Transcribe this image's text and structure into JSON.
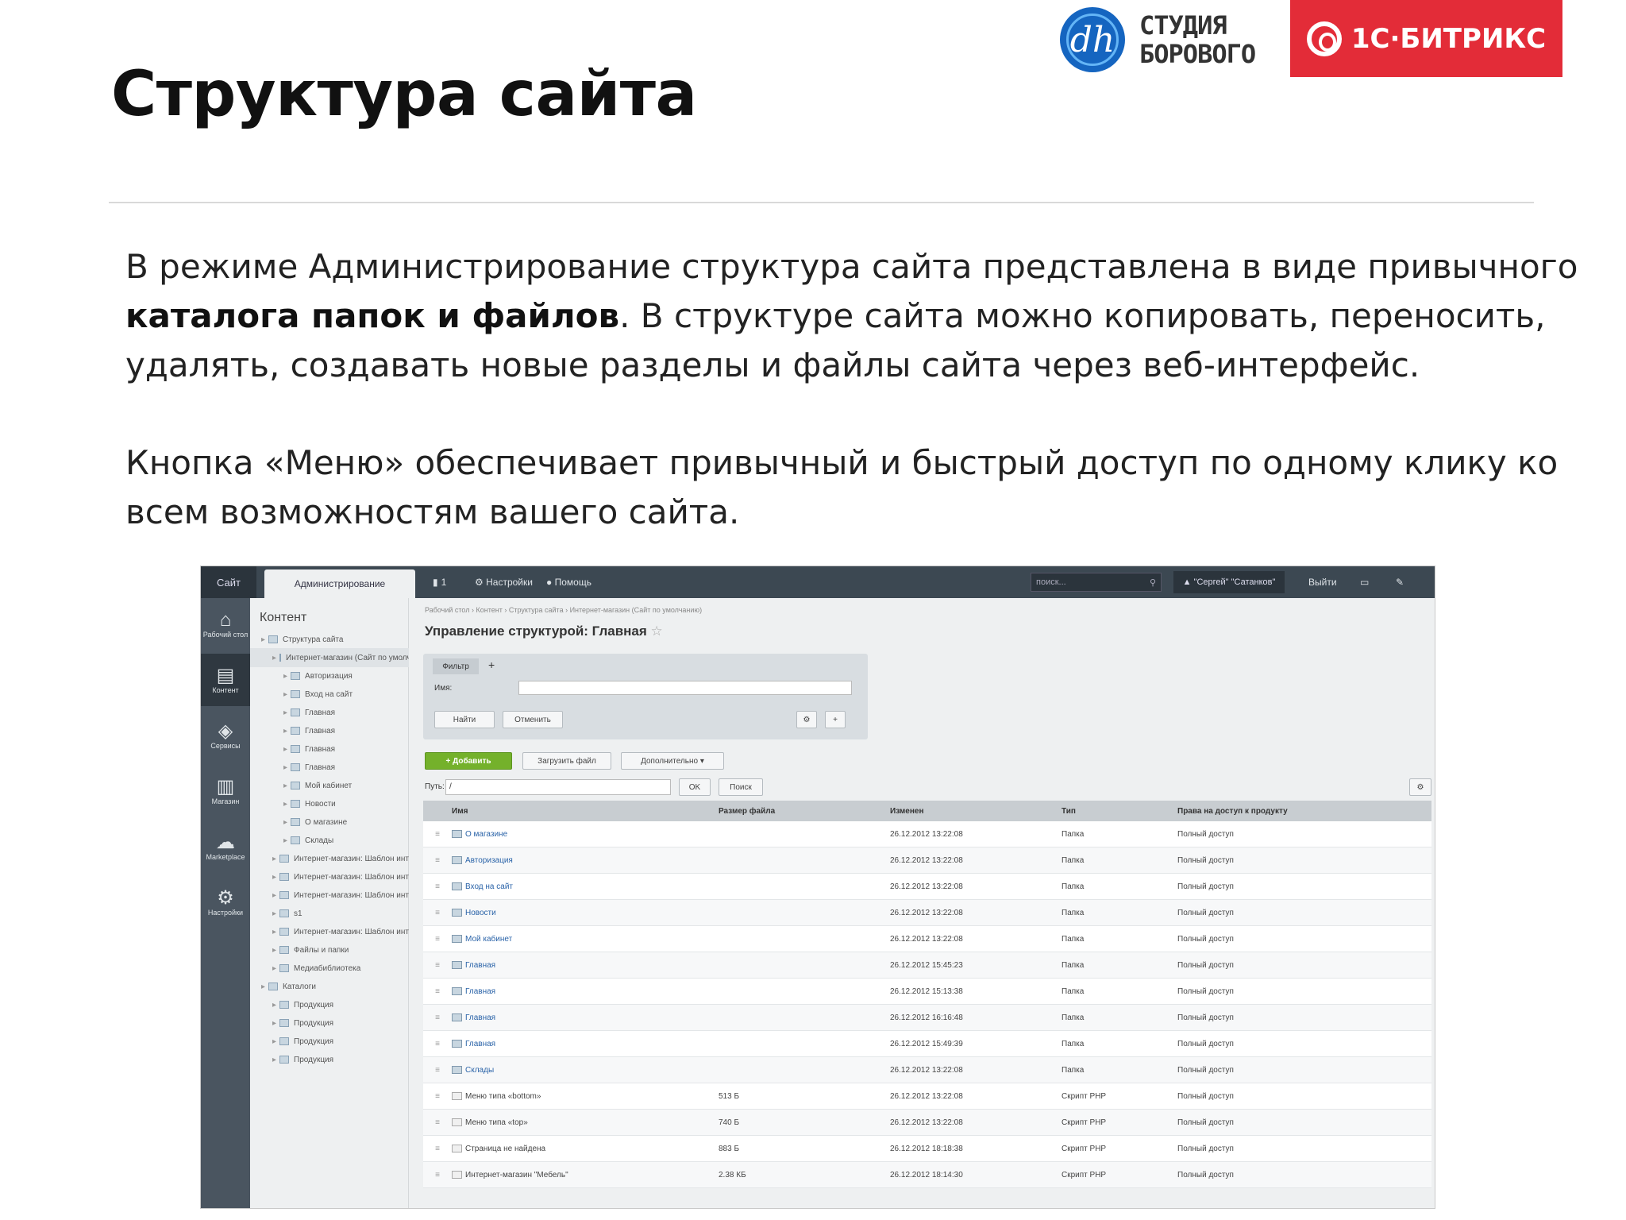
{
  "slide": {
    "title": "Структура сайта",
    "paragraph1_part1": "В режиме Администрирование структура сайта  представлена в виде привычного ",
    "paragraph1_bold": "каталога папок и файлов",
    "paragraph1_part2": ". В структуре сайта можно копировать, переносить, удалять, создавать новые разделы и файлы сайта через веб-интерфейс.",
    "paragraph2": "Кнопка «Меню» обеспечивает привычный и быстрый доступ по одному клику ко всем возможностям вашего сайта."
  },
  "logos": {
    "studio_mark": "dh",
    "studio_line1": "СТУДИЯ",
    "studio_line2": "БОРОВОГО",
    "bitrix": "1С·БИТРИКС",
    "bitrix_color": "#e32c38"
  },
  "admin": {
    "topbar": {
      "site_tab": "Сайт",
      "admin_tab": "Администрирование",
      "counter": "1",
      "settings": "Настройки",
      "help": "Помощь",
      "search_placeholder": "поиск...",
      "user": "\"Сергей\" \"Сатанков\"",
      "logout": "Выйти"
    },
    "leftnav": [
      {
        "icon": "home-icon",
        "glyph": "⌂",
        "label": "Рабочий стол"
      },
      {
        "icon": "document-icon",
        "glyph": "▤",
        "label": "Контент"
      },
      {
        "icon": "layers-icon",
        "glyph": "◈",
        "label": "Сервисы"
      },
      {
        "icon": "shop-icon",
        "glyph": "▥",
        "label": "Магазин"
      },
      {
        "icon": "cloud-icon",
        "glyph": "☁",
        "label": "Marketplace"
      },
      {
        "icon": "gear-icon",
        "glyph": "⚙",
        "label": "Настройки"
      }
    ],
    "tree": {
      "heading": "Контент",
      "items": [
        {
          "label": "Структура сайта",
          "indent": 0
        },
        {
          "label": "Интернет-магазин (Сайт по умолч.)",
          "indent": 1,
          "selected": true
        },
        {
          "label": "Авторизация",
          "indent": 2
        },
        {
          "label": "Вход на сайт",
          "indent": 2
        },
        {
          "label": "Главная",
          "indent": 2
        },
        {
          "label": "Главная",
          "indent": 2
        },
        {
          "label": "Главная",
          "indent": 2
        },
        {
          "label": "Главная",
          "indent": 2
        },
        {
          "label": "Мой кабинет",
          "indent": 2
        },
        {
          "label": "Новости",
          "indent": 2
        },
        {
          "label": "О магазине",
          "indent": 2
        },
        {
          "label": "Склады",
          "indent": 2
        },
        {
          "label": "Интернет-магазин: Шаблон инт",
          "indent": 1
        },
        {
          "label": "Интернет-магазин: Шаблон инт",
          "indent": 1
        },
        {
          "label": "Интернет-магазин: Шаблон инт",
          "indent": 1
        },
        {
          "label": "s1",
          "indent": 1
        },
        {
          "label": "Интернет-магазин: Шаблон инт",
          "indent": 1
        },
        {
          "label": "Файлы и папки",
          "indent": 1
        },
        {
          "label": "Медиабиблиотека",
          "indent": 1
        },
        {
          "label": "Каталоги",
          "indent": 0
        },
        {
          "label": "Продукция",
          "indent": 1
        },
        {
          "label": "Продукция",
          "indent": 1
        },
        {
          "label": "Продукция",
          "indent": 1
        },
        {
          "label": "Продукция",
          "indent": 1
        }
      ]
    },
    "main": {
      "breadcrumb": "Рабочий стол  ›  Контент  ›  Структура сайта  ›  Интернет-магазин (Сайт по умолчанию)",
      "heading": "Управление структурой: Главная",
      "filter_tab": "Фильтр",
      "filter_label": "Имя:",
      "find_button": "Найти",
      "cancel_button": "Отменить",
      "add_button": "+ Добавить",
      "upload_button": "Загрузить файл",
      "more_button": "Дополнительно",
      "path_label": "Путь:",
      "path_value": "/",
      "ok_button": "OK",
      "search_button": "Поиск",
      "columns": [
        "Имя",
        "Размер файла",
        "Изменен",
        "Тип",
        "Права на доступ к продукту"
      ],
      "rows": [
        {
          "name": "О магазине",
          "size": "",
          "date": "26.12.2012 13:22:08",
          "type": "Папка",
          "access": "Полный доступ",
          "folder": true
        },
        {
          "name": "Авторизация",
          "size": "",
          "date": "26.12.2012 13:22:08",
          "type": "Папка",
          "access": "Полный доступ",
          "folder": true
        },
        {
          "name": "Вход на сайт",
          "size": "",
          "date": "26.12.2012 13:22:08",
          "type": "Папка",
          "access": "Полный доступ",
          "folder": true
        },
        {
          "name": "Новости",
          "size": "",
          "date": "26.12.2012 13:22:08",
          "type": "Папка",
          "access": "Полный доступ",
          "folder": true
        },
        {
          "name": "Мой кабинет",
          "size": "",
          "date": "26.12.2012 13:22:08",
          "type": "Папка",
          "access": "Полный доступ",
          "folder": true
        },
        {
          "name": "Главная",
          "size": "",
          "date": "26.12.2012 15:45:23",
          "type": "Папка",
          "access": "Полный доступ",
          "folder": true
        },
        {
          "name": "Главная",
          "size": "",
          "date": "26.12.2012 15:13:38",
          "type": "Папка",
          "access": "Полный доступ",
          "folder": true
        },
        {
          "name": "Главная",
          "size": "",
          "date": "26.12.2012 16:16:48",
          "type": "Папка",
          "access": "Полный доступ",
          "folder": true
        },
        {
          "name": "Главная",
          "size": "",
          "date": "26.12.2012 15:49:39",
          "type": "Папка",
          "access": "Полный доступ",
          "folder": true
        },
        {
          "name": "Склады",
          "size": "",
          "date": "26.12.2012 13:22:08",
          "type": "Папка",
          "access": "Полный доступ",
          "folder": true
        },
        {
          "name": "Меню типа «bottom»",
          "size": "513 Б",
          "date": "26.12.2012 13:22:08",
          "type": "Скрипт PHP",
          "access": "Полный доступ",
          "folder": false
        },
        {
          "name": "Меню типа «top»",
          "size": "740 Б",
          "date": "26.12.2012 13:22:08",
          "type": "Скрипт PHP",
          "access": "Полный доступ",
          "folder": false
        },
        {
          "name": "Страница не найдена",
          "size": "883 Б",
          "date": "26.12.2012 18:18:38",
          "type": "Скрипт PHP",
          "access": "Полный доступ",
          "folder": false
        },
        {
          "name": "Интернет-магазин \"Мебель\"",
          "size": "2.38 КБ",
          "date": "26.12.2012 18:14:30",
          "type": "Скрипт PHP",
          "access": "Полный доступ",
          "folder": false
        }
      ]
    }
  }
}
